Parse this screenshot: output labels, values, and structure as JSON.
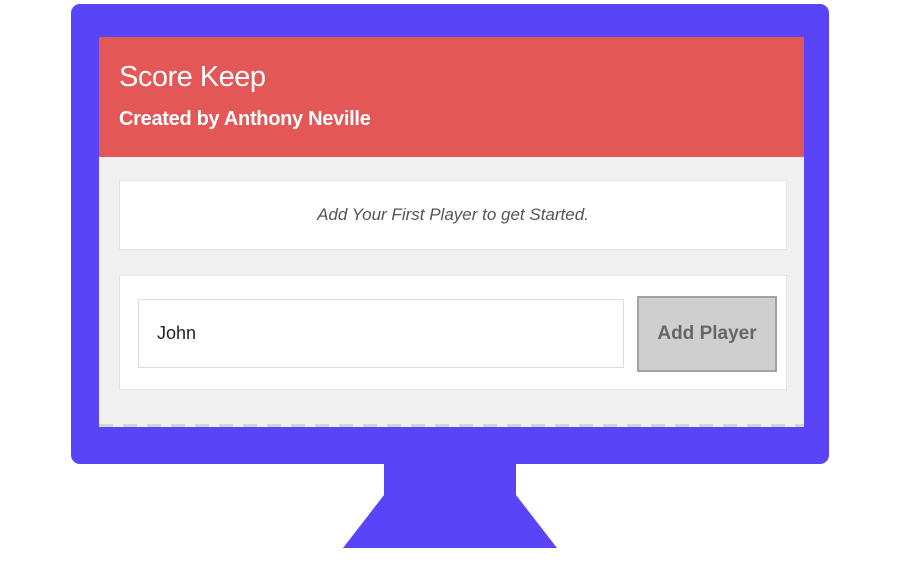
{
  "app": {
    "title": "Score Keep",
    "subtitle": "Created by Anthony Neville"
  },
  "message": {
    "text": "Add Your First Player to get Started."
  },
  "player_form": {
    "input_value": "John",
    "button_label": "Add Player"
  },
  "colors": {
    "monitor": "#5a44f8",
    "header": "#e35757",
    "background": "#f0f0f0"
  }
}
